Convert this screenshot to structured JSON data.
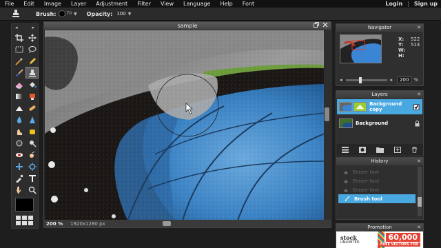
{
  "menubar": {
    "items": [
      "File",
      "Edit",
      "Image",
      "Layer",
      "Adjustment",
      "Filter",
      "View",
      "Language",
      "Help",
      "Font"
    ],
    "login": "Login",
    "separator": "|",
    "signup": "Sign up"
  },
  "options": {
    "brush_label": "Brush:",
    "brush_size": "70",
    "opacity_label": "Opacity:",
    "opacity_value": "100"
  },
  "toolbox": {
    "left_arrow": "◂",
    "right_arrow": "▸",
    "tools": [
      "crop-tool",
      "move-tool",
      "marquee-tool",
      "lasso-tool",
      "wand-tool",
      "pencil-tool",
      "brush-tool",
      "clone-stamp-tool",
      "eraser-tool",
      "bucket-tool",
      "gradient-tool",
      "red-eye-tool",
      "sharpen-tool",
      "smudge-tool",
      "drop-tool",
      "blur-tool",
      "burn-tool",
      "dodge-tool",
      "sponge-tool",
      "color-replace-tool",
      "bloat-tool",
      "pinch-tool",
      "spot-heal-tool",
      "eyedropper-tool",
      "text-tool",
      "hand-tool",
      "zoom-tool"
    ],
    "active_tool": "clone-stamp-tool"
  },
  "document": {
    "title": "sample",
    "zoom": "200",
    "zoom_unit": "%",
    "dimensions": "1920x1280 px"
  },
  "navigator": {
    "title": "Navigator",
    "x_label": "X:",
    "x_value": "522",
    "y_label": "Y:",
    "y_value": "514",
    "w_label": "W:",
    "w_value": "",
    "h_label": "H:",
    "h_value": "",
    "zoom_value": "200",
    "zoom_unit": "%",
    "zoom_fraction": 0.35
  },
  "layers": {
    "title": "Layers",
    "items": [
      {
        "name": "Background copy",
        "visible": true,
        "selected": true
      },
      {
        "name": "Background",
        "locked": true,
        "selected": false
      }
    ]
  },
  "history": {
    "title": "History",
    "items": [
      {
        "label": "Eraser tool",
        "active": false
      },
      {
        "label": "Eraser tool",
        "active": false
      },
      {
        "label": "Eraser tool",
        "active": false
      },
      {
        "label": "Brush tool",
        "active": true
      }
    ]
  },
  "promo": {
    "title": "Promotion",
    "brand": "stock",
    "brand_sub": "UNLIMITED",
    "headline": "60,000",
    "subline": "FREE VECTORS FOR"
  },
  "colors": {
    "accent": "#4aa8e0",
    "menubar_bg": "#121212",
    "panel_bg": "#2f2f2f",
    "wing_blue": "#3d86c6",
    "wing_black": "#1b1715"
  }
}
